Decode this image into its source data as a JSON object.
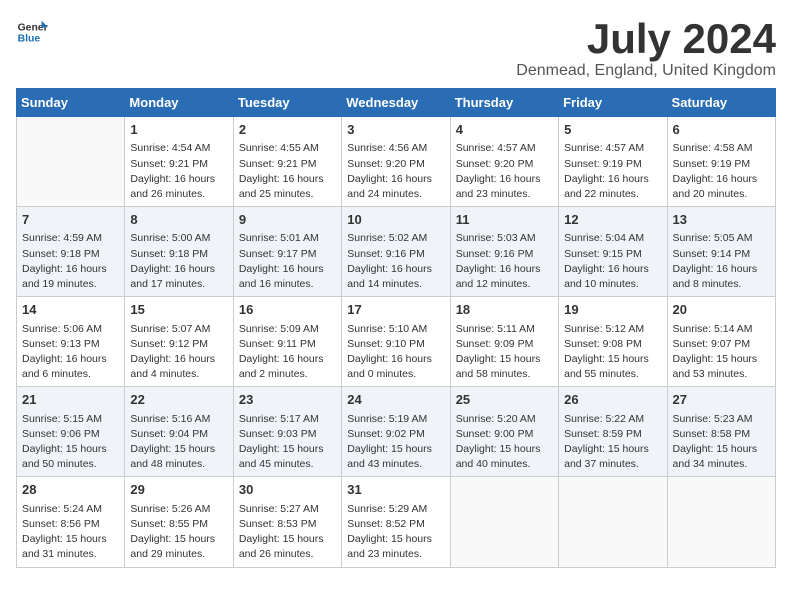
{
  "logo": {
    "general": "General",
    "blue": "Blue"
  },
  "title": "July 2024",
  "location": "Denmead, England, United Kingdom",
  "headers": [
    "Sunday",
    "Monday",
    "Tuesday",
    "Wednesday",
    "Thursday",
    "Friday",
    "Saturday"
  ],
  "weeks": [
    [
      {
        "day": "",
        "sunrise": "",
        "sunset": "",
        "daylight": ""
      },
      {
        "day": "1",
        "sunrise": "Sunrise: 4:54 AM",
        "sunset": "Sunset: 9:21 PM",
        "daylight": "Daylight: 16 hours and 26 minutes."
      },
      {
        "day": "2",
        "sunrise": "Sunrise: 4:55 AM",
        "sunset": "Sunset: 9:21 PM",
        "daylight": "Daylight: 16 hours and 25 minutes."
      },
      {
        "day": "3",
        "sunrise": "Sunrise: 4:56 AM",
        "sunset": "Sunset: 9:20 PM",
        "daylight": "Daylight: 16 hours and 24 minutes."
      },
      {
        "day": "4",
        "sunrise": "Sunrise: 4:57 AM",
        "sunset": "Sunset: 9:20 PM",
        "daylight": "Daylight: 16 hours and 23 minutes."
      },
      {
        "day": "5",
        "sunrise": "Sunrise: 4:57 AM",
        "sunset": "Sunset: 9:19 PM",
        "daylight": "Daylight: 16 hours and 22 minutes."
      },
      {
        "day": "6",
        "sunrise": "Sunrise: 4:58 AM",
        "sunset": "Sunset: 9:19 PM",
        "daylight": "Daylight: 16 hours and 20 minutes."
      }
    ],
    [
      {
        "day": "7",
        "sunrise": "Sunrise: 4:59 AM",
        "sunset": "Sunset: 9:18 PM",
        "daylight": "Daylight: 16 hours and 19 minutes."
      },
      {
        "day": "8",
        "sunrise": "Sunrise: 5:00 AM",
        "sunset": "Sunset: 9:18 PM",
        "daylight": "Daylight: 16 hours and 17 minutes."
      },
      {
        "day": "9",
        "sunrise": "Sunrise: 5:01 AM",
        "sunset": "Sunset: 9:17 PM",
        "daylight": "Daylight: 16 hours and 16 minutes."
      },
      {
        "day": "10",
        "sunrise": "Sunrise: 5:02 AM",
        "sunset": "Sunset: 9:16 PM",
        "daylight": "Daylight: 16 hours and 14 minutes."
      },
      {
        "day": "11",
        "sunrise": "Sunrise: 5:03 AM",
        "sunset": "Sunset: 9:16 PM",
        "daylight": "Daylight: 16 hours and 12 minutes."
      },
      {
        "day": "12",
        "sunrise": "Sunrise: 5:04 AM",
        "sunset": "Sunset: 9:15 PM",
        "daylight": "Daylight: 16 hours and 10 minutes."
      },
      {
        "day": "13",
        "sunrise": "Sunrise: 5:05 AM",
        "sunset": "Sunset: 9:14 PM",
        "daylight": "Daylight: 16 hours and 8 minutes."
      }
    ],
    [
      {
        "day": "14",
        "sunrise": "Sunrise: 5:06 AM",
        "sunset": "Sunset: 9:13 PM",
        "daylight": "Daylight: 16 hours and 6 minutes."
      },
      {
        "day": "15",
        "sunrise": "Sunrise: 5:07 AM",
        "sunset": "Sunset: 9:12 PM",
        "daylight": "Daylight: 16 hours and 4 minutes."
      },
      {
        "day": "16",
        "sunrise": "Sunrise: 5:09 AM",
        "sunset": "Sunset: 9:11 PM",
        "daylight": "Daylight: 16 hours and 2 minutes."
      },
      {
        "day": "17",
        "sunrise": "Sunrise: 5:10 AM",
        "sunset": "Sunset: 9:10 PM",
        "daylight": "Daylight: 16 hours and 0 minutes."
      },
      {
        "day": "18",
        "sunrise": "Sunrise: 5:11 AM",
        "sunset": "Sunset: 9:09 PM",
        "daylight": "Daylight: 15 hours and 58 minutes."
      },
      {
        "day": "19",
        "sunrise": "Sunrise: 5:12 AM",
        "sunset": "Sunset: 9:08 PM",
        "daylight": "Daylight: 15 hours and 55 minutes."
      },
      {
        "day": "20",
        "sunrise": "Sunrise: 5:14 AM",
        "sunset": "Sunset: 9:07 PM",
        "daylight": "Daylight: 15 hours and 53 minutes."
      }
    ],
    [
      {
        "day": "21",
        "sunrise": "Sunrise: 5:15 AM",
        "sunset": "Sunset: 9:06 PM",
        "daylight": "Daylight: 15 hours and 50 minutes."
      },
      {
        "day": "22",
        "sunrise": "Sunrise: 5:16 AM",
        "sunset": "Sunset: 9:04 PM",
        "daylight": "Daylight: 15 hours and 48 minutes."
      },
      {
        "day": "23",
        "sunrise": "Sunrise: 5:17 AM",
        "sunset": "Sunset: 9:03 PM",
        "daylight": "Daylight: 15 hours and 45 minutes."
      },
      {
        "day": "24",
        "sunrise": "Sunrise: 5:19 AM",
        "sunset": "Sunset: 9:02 PM",
        "daylight": "Daylight: 15 hours and 43 minutes."
      },
      {
        "day": "25",
        "sunrise": "Sunrise: 5:20 AM",
        "sunset": "Sunset: 9:00 PM",
        "daylight": "Daylight: 15 hours and 40 minutes."
      },
      {
        "day": "26",
        "sunrise": "Sunrise: 5:22 AM",
        "sunset": "Sunset: 8:59 PM",
        "daylight": "Daylight: 15 hours and 37 minutes."
      },
      {
        "day": "27",
        "sunrise": "Sunrise: 5:23 AM",
        "sunset": "Sunset: 8:58 PM",
        "daylight": "Daylight: 15 hours and 34 minutes."
      }
    ],
    [
      {
        "day": "28",
        "sunrise": "Sunrise: 5:24 AM",
        "sunset": "Sunset: 8:56 PM",
        "daylight": "Daylight: 15 hours and 31 minutes."
      },
      {
        "day": "29",
        "sunrise": "Sunrise: 5:26 AM",
        "sunset": "Sunset: 8:55 PM",
        "daylight": "Daylight: 15 hours and 29 minutes."
      },
      {
        "day": "30",
        "sunrise": "Sunrise: 5:27 AM",
        "sunset": "Sunset: 8:53 PM",
        "daylight": "Daylight: 15 hours and 26 minutes."
      },
      {
        "day": "31",
        "sunrise": "Sunrise: 5:29 AM",
        "sunset": "Sunset: 8:52 PM",
        "daylight": "Daylight: 15 hours and 23 minutes."
      },
      {
        "day": "",
        "sunrise": "",
        "sunset": "",
        "daylight": ""
      },
      {
        "day": "",
        "sunrise": "",
        "sunset": "",
        "daylight": ""
      },
      {
        "day": "",
        "sunrise": "",
        "sunset": "",
        "daylight": ""
      }
    ]
  ]
}
